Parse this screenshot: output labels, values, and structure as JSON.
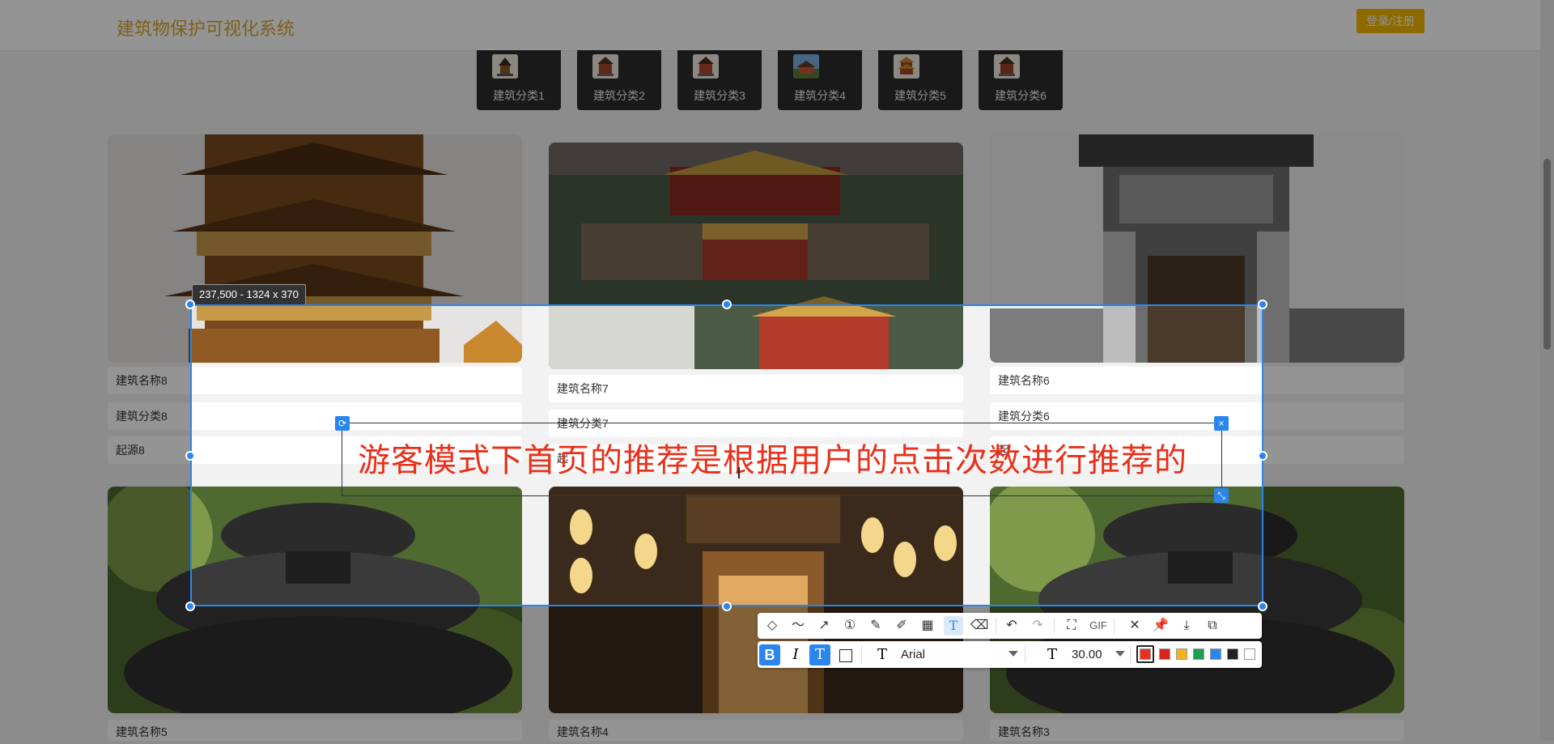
{
  "header": {
    "site_title": "建筑物保护可视化系统",
    "login_label": "登录/注册"
  },
  "categories": [
    {
      "label": "建筑分类1"
    },
    {
      "label": "建筑分类2"
    },
    {
      "label": "建筑分类3"
    },
    {
      "label": "建筑分类4"
    },
    {
      "label": "建筑分类5"
    },
    {
      "label": "建筑分类6"
    }
  ],
  "cards_row1": [
    {
      "name": "建筑名称8",
      "category": "建筑分类8",
      "origin": "起源8"
    },
    {
      "name": "建筑名称7",
      "category": "建筑分类7",
      "origin": "起"
    },
    {
      "name": "建筑名称6",
      "category": "建筑分类6",
      "origin": "起"
    }
  ],
  "cards_row2": [
    {
      "name": "建筑名称5"
    },
    {
      "name": "建筑名称4"
    },
    {
      "name": "建筑名称3"
    }
  ],
  "capture": {
    "size_readout": "237,500 - 1324 x 370",
    "annotation_text": "游客模式下首页的推荐是根据用户的点击次数进行推荐的"
  },
  "toolbar": {
    "gif_label": "GIF",
    "font_name": "Arial",
    "font_size": "30.00",
    "colors": [
      "#e8301a",
      "#d9241c",
      "#f3b31d",
      "#1f9e53",
      "#2a86ee",
      "#222222",
      "#ffffff"
    ],
    "selected_color": "#e8301a",
    "icons": [
      "shape-icon",
      "curve-icon",
      "arrow-icon",
      "number-marker-icon",
      "pen-icon",
      "highlighter-icon",
      "mosaic-icon",
      "text-icon",
      "eraser-icon",
      "undo-icon",
      "redo-icon",
      "ocr-icon",
      "gif-icon",
      "close-icon",
      "pin-icon",
      "download-icon",
      "copy-icon"
    ]
  }
}
